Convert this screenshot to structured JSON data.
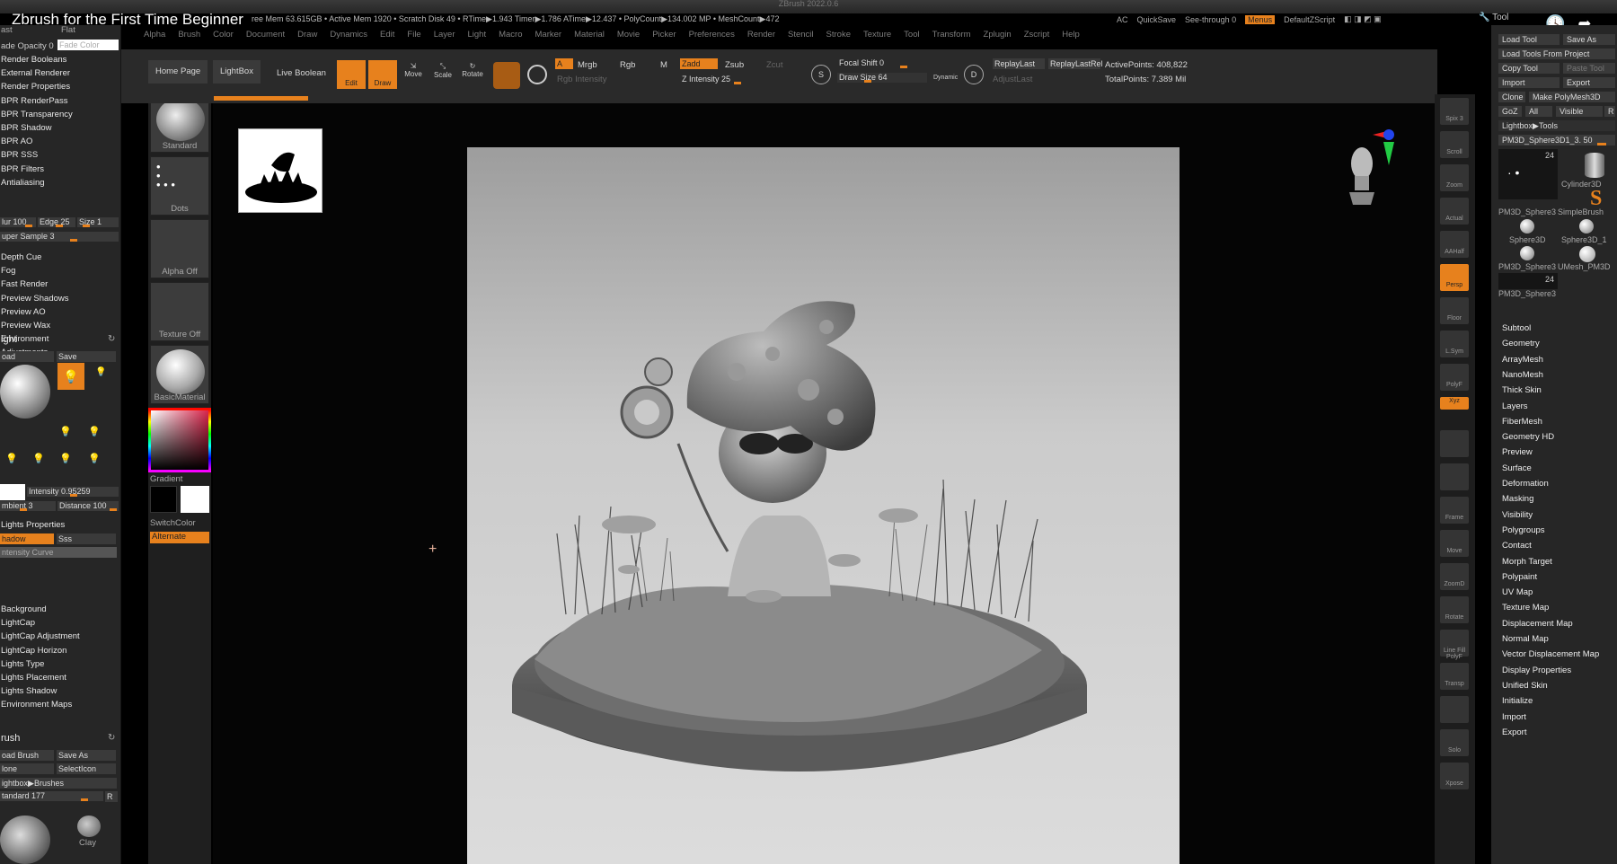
{
  "video": {
    "title": "Zbrush for the First Time Beginner",
    "app_title": "ZBrush 2022.0.6"
  },
  "status": {
    "line": "ree Mem 63.615GB • Active Mem 1920 • Scratch Disk 49 • RTime▶1.943 Timer▶1.786 ATime▶12.437 • PolyCount▶134.002 MP • MeshCount▶472"
  },
  "menubar": [
    "Alpha",
    "Brush",
    "Color",
    "Document",
    "Draw",
    "Dynamics",
    "Edit",
    "File",
    "Layer",
    "Light",
    "Macro",
    "Marker",
    "Material",
    "Movie",
    "Picker",
    "Preferences",
    "Render",
    "Stencil",
    "Stroke",
    "Texture",
    "Tool",
    "Transform",
    "Zplugin",
    "Zscript",
    "Help"
  ],
  "quickstrip": {
    "ac": "AC",
    "quicksave": "QuickSave",
    "seethrough": "See-through  0",
    "menus": "Menus",
    "script": "DefaultZScript"
  },
  "topright": {
    "tool_label": "Tool"
  },
  "left_panel": {
    "top_labels": {
      "cast": "ast",
      "flat": "Flat"
    },
    "fade_opacity": "ade Opacity 0",
    "fade_color": "Fade Color",
    "render_items": [
      "Render Booleans",
      "External Renderer",
      "Render Properties",
      "BPR RenderPass",
      "BPR Transparency",
      "BPR Shadow",
      "BPR AO",
      "BPR SSS",
      "BPR Filters",
      "Antialiasing"
    ],
    "aa_blur": "lur 100",
    "aa_edge": "Edge 25",
    "aa_size": "Size 1",
    "aa_super": "uper Sample 3",
    "render_items2": [
      "Depth Cue",
      "Fog",
      "Fast Render",
      "Preview Shadows",
      "Preview AO",
      "Preview Wax",
      "Environment",
      "Adjustments"
    ],
    "light_section": "ight",
    "light_load": "oad",
    "light_save": "Save",
    "intensity": "Intensity 0.95259",
    "ambient": "mbient 3",
    "distance": "Distance 100",
    "lights_properties": "Lights Properties",
    "shadow": "hadow",
    "sss": "Sss",
    "intensity_curve": "ntensity Curve",
    "light_items": [
      "Background",
      "LightCap",
      "LightCap Adjustment",
      "LightCap Horizon",
      "Lights Type",
      "Lights Placement",
      "Lights Shadow",
      "Environment Maps"
    ],
    "brush_section": "rush",
    "load_brush": "oad Brush",
    "save_as": "Save As",
    "clone": "lone",
    "selection": "SelectIcon",
    "lightbox_brushes": "ightbox▶Brushes",
    "standard": "tandard  177",
    "r": "R",
    "clay": "Clay"
  },
  "left_shelf": {
    "standard": "Standard",
    "dots": "Dots",
    "alpha": "Alpha Off",
    "texture": "Texture Off",
    "material": "BasicMaterial",
    "gradient": "Gradient",
    "switchcolor": "SwitchColor",
    "alternate": "Alternate"
  },
  "toolbar": {
    "home": "Home Page",
    "lightbox": "LightBox",
    "live_boolean": "Live Boolean",
    "edit": "Edit",
    "draw": "Draw",
    "move": "Move",
    "scale": "Scale",
    "rotate": "Rotate",
    "a": "A",
    "mrgb": "Mrgb",
    "rgb": "Rgb",
    "m": "M",
    "rgb_intensity": "Rgb Intensity",
    "zadd": "Zadd",
    "zsub": "Zsub",
    "zcut": "Zcut",
    "z_intensity": "Z Intensity 25",
    "focal_shift": "Focal Shift 0",
    "draw_size": "Draw Size 64",
    "dynamic": "Dynamic",
    "replay_last": "ReplayLast",
    "replay_last_rel": "ReplayLastRel",
    "adjust_last": "AdjustLast",
    "active_points": "ActivePoints: 408,822",
    "total_points": "TotalPoints: 7.389 Mil"
  },
  "right_shelf": [
    "Spix 3",
    "Scroll",
    "Zoom",
    "Actual",
    "AAHalf",
    "Persp",
    "Floor",
    "L.Sym",
    "PolyF",
    "Xyz",
    "",
    "",
    "Frame",
    "Move",
    "ZoomD",
    "Rotate",
    "Line Fill PolyF",
    "Transp",
    "",
    "Solo",
    "Xpose"
  ],
  "right_panel": {
    "load_tool": "Load Tool",
    "save_as": "Save As",
    "load_project": "Load Tools From Project",
    "copy_tool": "Copy Tool",
    "paste_tool": "Paste Tool",
    "import": "Import",
    "export": "Export",
    "clone": "Clone",
    "make_polymesh": "Make PolyMesh3D",
    "goz": "GoZ",
    "all": "All",
    "visible": "Visible",
    "r": "R",
    "lightbox_tools": "Lightbox▶Tools",
    "current_tool": "PM3D_Sphere3D1_3. 50",
    "tools": [
      "PM3D_Sphere3",
      "SimpleBrush",
      "Sphere3D",
      "Sphere3D_1",
      "PM3D_Sphere3",
      "UMesh_PM3D",
      "PM3D_Sphere3"
    ],
    "cylinder": "Cylinder3D",
    "count_24a": "24",
    "count_24b": "24",
    "items": [
      "Subtool",
      "Geometry",
      "ArrayMesh",
      "NanoMesh",
      "Thick Skin",
      "Layers",
      "FiberMesh",
      "Geometry HD",
      "Preview",
      "Surface",
      "Deformation",
      "Masking",
      "Visibility",
      "Polygroups",
      "Contact",
      "Morph Target",
      "Polypaint",
      "UV Map",
      "Texture Map",
      "Displacement Map",
      "Normal Map",
      "Vector Displacement Map",
      "Display Properties",
      "Unified Skin",
      "Initialize",
      "Import",
      "Export"
    ]
  }
}
